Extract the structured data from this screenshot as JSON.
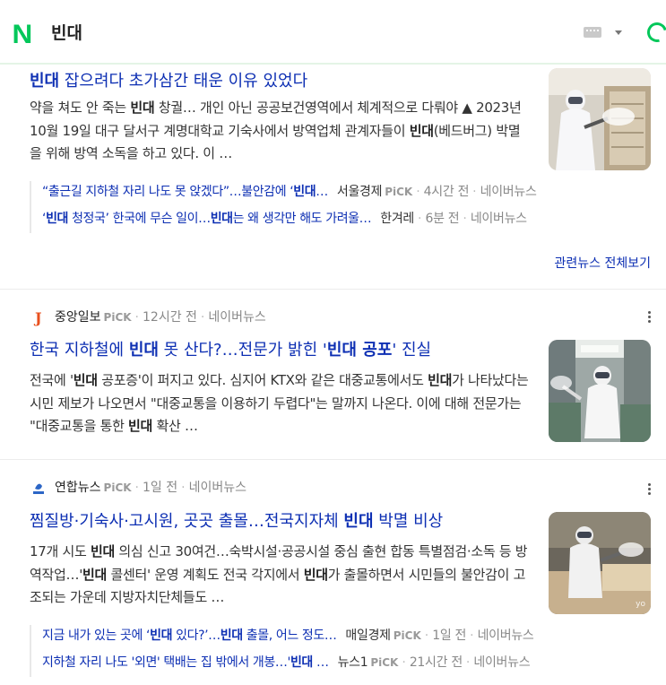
{
  "header": {
    "logo": "N",
    "query": "빈대",
    "keyboard_icon": "keyboard-icon",
    "dropdown_icon": "caret-down-icon",
    "loading_icon": "loading-spinner-icon",
    "brand_color": "#03c75a"
  },
  "articles": [
    {
      "title_parts": [
        [
          "빈대",
          true
        ],
        [
          " 잡으려다 초가삼간 태운 이유 있었다",
          false
        ]
      ],
      "desc_parts": [
        [
          "약을 쳐도 안 죽는 ",
          false
        ],
        [
          "빈대",
          true
        ],
        [
          " 창궐… 개인 아닌 공공보건영역에서 체계적으로 다뤄야 ▲ 2023년 10월 19일 대구 달서구 계명대학교 기숙사에서 방역업체 관계자들이 ",
          false
        ],
        [
          "빈대",
          true
        ],
        [
          "(베드버그) 박멸을 위해 방역 소독을 하고 있다. 이 …",
          false
        ]
      ],
      "thumbnail": "photo-disinfection-dormitory",
      "related": [
        {
          "title_parts": [
            [
              "“출근길 지하철 자리 나도 못 앉겠다”…불안감에 ‘",
              false
            ],
            [
              "빈대",
              true
            ],
            [
              "…",
              false
            ]
          ],
          "press": "서울경제",
          "pick": "PiCK",
          "time": "4시간 전",
          "portal": "네이버뉴스"
        },
        {
          "title_parts": [
            [
              "‘",
              false
            ],
            [
              "빈대",
              true
            ],
            [
              " 청정국’ 한국에 무슨 일이…",
              false
            ],
            [
              "빈대",
              true
            ],
            [
              "는 왜 생각만 해도 가려울…",
              false
            ]
          ],
          "press": "한겨레",
          "pick": "",
          "time": "6분 전",
          "portal": "네이버뉴스"
        }
      ],
      "more_label": "관련뉴스 전체보기"
    },
    {
      "source": {
        "name": "중앙일보",
        "pick": "PiCK",
        "time": "12시간 전",
        "portal": "네이버뉴스",
        "logo": "J"
      },
      "title_parts": [
        [
          "한국 지하철에 ",
          false
        ],
        [
          "빈대",
          true
        ],
        [
          " 못 산다?…전문가 밝힌 '",
          false
        ],
        [
          "빈대 공포",
          true
        ],
        [
          "' 진실",
          false
        ]
      ],
      "desc_parts": [
        [
          "전국에 '",
          false
        ],
        [
          "빈대",
          true
        ],
        [
          " 공포증'이 퍼지고 있다. 심지어 KTX와 같은 대중교통에서도 ",
          false
        ],
        [
          "빈대",
          true
        ],
        [
          "가 나타났다는 시민 제보가 나오면서 \"대중교통을 이용하기 두렵다\"는 말까지 나온다. 이에 대해 전문가는 \"대중교통을 통한 ",
          false
        ],
        [
          "빈대",
          true
        ],
        [
          " 확산 …",
          false
        ]
      ],
      "thumbnail": "photo-subway-disinfection"
    },
    {
      "source": {
        "name": "연합뉴스",
        "pick": "PiCK",
        "time": "1일 전",
        "portal": "네이버뉴스",
        "logo": "yonhap-logo-icon"
      },
      "title_parts": [
        [
          "찜질방·기숙사·고시원, 곳곳 출몰…전국지자체 ",
          false
        ],
        [
          "빈대",
          true
        ],
        [
          " 박멸 비상",
          false
        ]
      ],
      "desc_parts": [
        [
          "17개 시도 ",
          false
        ],
        [
          "빈대",
          true
        ],
        [
          " 의심 신고 30여건…숙박시설·공공시설 중심 출현 합동 특별점검·소독 등 방역작업…'",
          false
        ],
        [
          "빈대",
          true
        ],
        [
          " 콜센터' 운영 계획도 전국 각지에서 ",
          false
        ],
        [
          "빈대",
          true
        ],
        [
          "가 출몰하면서 시민들의 불안감이 고조되는 가운데 지방자치단체들도 …",
          false
        ]
      ],
      "thumbnail": "photo-room-disinfection",
      "thumb_badge": "yo",
      "related": [
        {
          "title_parts": [
            [
              "지금 내가 있는 곳에 ‘",
              false
            ],
            [
              "빈대",
              true
            ],
            [
              " 있다?’…",
              false
            ],
            [
              "빈대",
              true
            ],
            [
              " 출몰, 어느 정도…",
              false
            ]
          ],
          "press": "매일경제",
          "pick": "PiCK",
          "time": "1일 전",
          "portal": "네이버뉴스"
        },
        {
          "title_parts": [
            [
              "지하철 자리 나도 '외면' 택배는 집 밖에서 개봉…'",
              false
            ],
            [
              "빈대",
              true
            ],
            [
              " …",
              false
            ]
          ],
          "press": "뉴스1",
          "pick": "PiCK",
          "time": "21시간 전",
          "portal": "네이버뉴스"
        }
      ]
    }
  ]
}
